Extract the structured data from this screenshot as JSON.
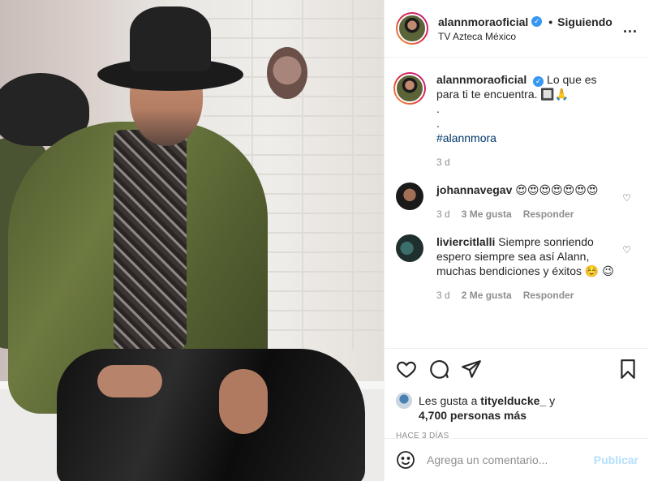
{
  "post": {
    "author": "alannmoraoficial",
    "follow_status": "Siguiendo",
    "separator": "•",
    "location": "TV Azteca México",
    "more_label": "...",
    "caption_text": "Lo que es para ti te encuentra. 🔲🙏",
    "caption_dot1": ".",
    "caption_dot2": ".",
    "hashtag": "#alannmora",
    "caption_age": "3 d"
  },
  "comments": [
    {
      "user": "johannavegav",
      "text": "😍😍😍😍😍😍😍",
      "age": "3 d",
      "likes": "3 Me gusta",
      "reply": "Responder"
    },
    {
      "user": "liviercitlalli",
      "text": "Siempre sonriendo espero siempre sea así Alann, muchas bendiciones y éxitos ☺️ 😉",
      "age": "3 d",
      "likes": "2 Me gusta",
      "reply": "Responder"
    }
  ],
  "likes": {
    "prefix": "Les gusta a",
    "first_user": "tityelducke_",
    "joiner": "y",
    "others": "4,700 personas más"
  },
  "timestamp": "HACE 3 DÍAS",
  "comment_box": {
    "placeholder": "Agrega un comentario...",
    "publish_label": "Publicar"
  },
  "icons": {
    "like": "heart-icon",
    "comment": "comment-icon",
    "share": "share-icon",
    "save": "bookmark-icon",
    "emoji": "emoji-icon"
  },
  "colors": {
    "verified": "#3897f0",
    "hashtag": "#00376b",
    "muted": "#8e8e8e",
    "publish_disabled": "#b2dffc"
  }
}
